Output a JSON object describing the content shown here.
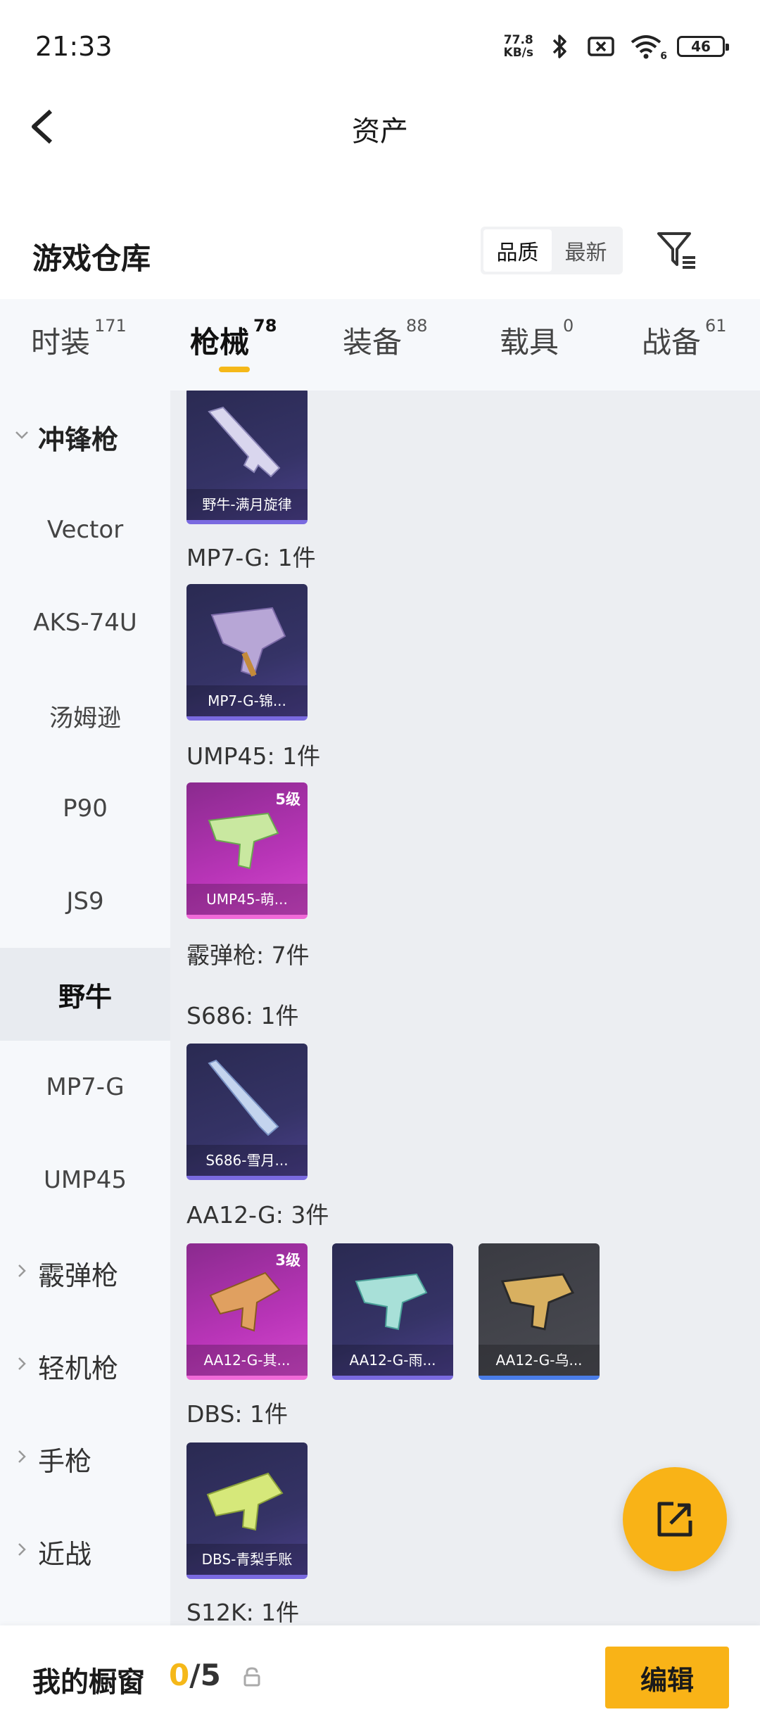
{
  "status": {
    "time": "21:33",
    "net_speed_value": "77.8",
    "net_speed_unit": "KB/s",
    "wifi_badge": "6",
    "battery": "46"
  },
  "header": {
    "title": "资产"
  },
  "section": {
    "title": "游戏仓库",
    "sort_options": [
      "品质",
      "最新"
    ],
    "sort_selected": "品质"
  },
  "tabs": [
    {
      "label": "时装",
      "count": "171"
    },
    {
      "label": "枪械",
      "count": "78"
    },
    {
      "label": "装备",
      "count": "88"
    },
    {
      "label": "载具",
      "count": "0"
    },
    {
      "label": "战备",
      "count": "61"
    }
  ],
  "active_tab": "枪械",
  "sidebar": {
    "items": [
      {
        "label": "冲锋枪",
        "type": "category",
        "expanded": true
      },
      {
        "label": "Vector",
        "type": "weapon"
      },
      {
        "label": "AKS-74U",
        "type": "weapon"
      },
      {
        "label": "汤姆逊",
        "type": "weapon"
      },
      {
        "label": "P90",
        "type": "weapon"
      },
      {
        "label": "JS9",
        "type": "weapon"
      },
      {
        "label": "野牛",
        "type": "weapon",
        "selected": true
      },
      {
        "label": "MP7-G",
        "type": "weapon"
      },
      {
        "label": "UMP45",
        "type": "weapon"
      },
      {
        "label": "霰弹枪",
        "type": "category",
        "expanded": false
      },
      {
        "label": "轻机枪",
        "type": "category",
        "expanded": false
      },
      {
        "label": "手枪",
        "type": "category",
        "expanded": false
      },
      {
        "label": "近战",
        "type": "category",
        "expanded": false
      }
    ]
  },
  "content": {
    "groups": [
      {
        "label": "",
        "cards": [
          {
            "name": "野牛-满月旋律",
            "tier": "purple",
            "level": ""
          }
        ]
      },
      {
        "label": "MP7-G: 1件",
        "cards": [
          {
            "name": "MP7-G-锦...",
            "tier": "purple",
            "level": ""
          }
        ]
      },
      {
        "label": "UMP45: 1件",
        "cards": [
          {
            "name": "UMP45-萌...",
            "tier": "pink",
            "level": "5级"
          }
        ]
      },
      {
        "label": "霰弹枪: 7件",
        "cards": []
      },
      {
        "label": "S686: 1件",
        "cards": [
          {
            "name": "S686-雪月...",
            "tier": "purple",
            "level": ""
          }
        ]
      },
      {
        "label": "AA12-G: 3件",
        "cards": [
          {
            "name": "AA12-G-其...",
            "tier": "pink",
            "level": "3级"
          },
          {
            "name": "AA12-G-雨...",
            "tier": "purple",
            "level": ""
          },
          {
            "name": "AA12-G-乌...",
            "tier": "gray",
            "level": ""
          }
        ]
      },
      {
        "label": "DBS: 1件",
        "cards": [
          {
            "name": "DBS-青梨手账",
            "tier": "purple",
            "level": ""
          }
        ]
      },
      {
        "label": "S12K: 1件",
        "cards": []
      }
    ]
  },
  "bottombar": {
    "label": "我的橱窗",
    "current": "0",
    "separator_total": "/5",
    "edit_label": "编辑"
  },
  "colors": {
    "accent": "#f9b317",
    "sidebar_bg": "#f6f8fb",
    "content_bg": "#eceef2"
  },
  "icons": [
    "back-arrow-icon",
    "filter-icon",
    "share-icon",
    "lock-icon",
    "bluetooth-icon",
    "wifi-icon",
    "battery-icon"
  ]
}
